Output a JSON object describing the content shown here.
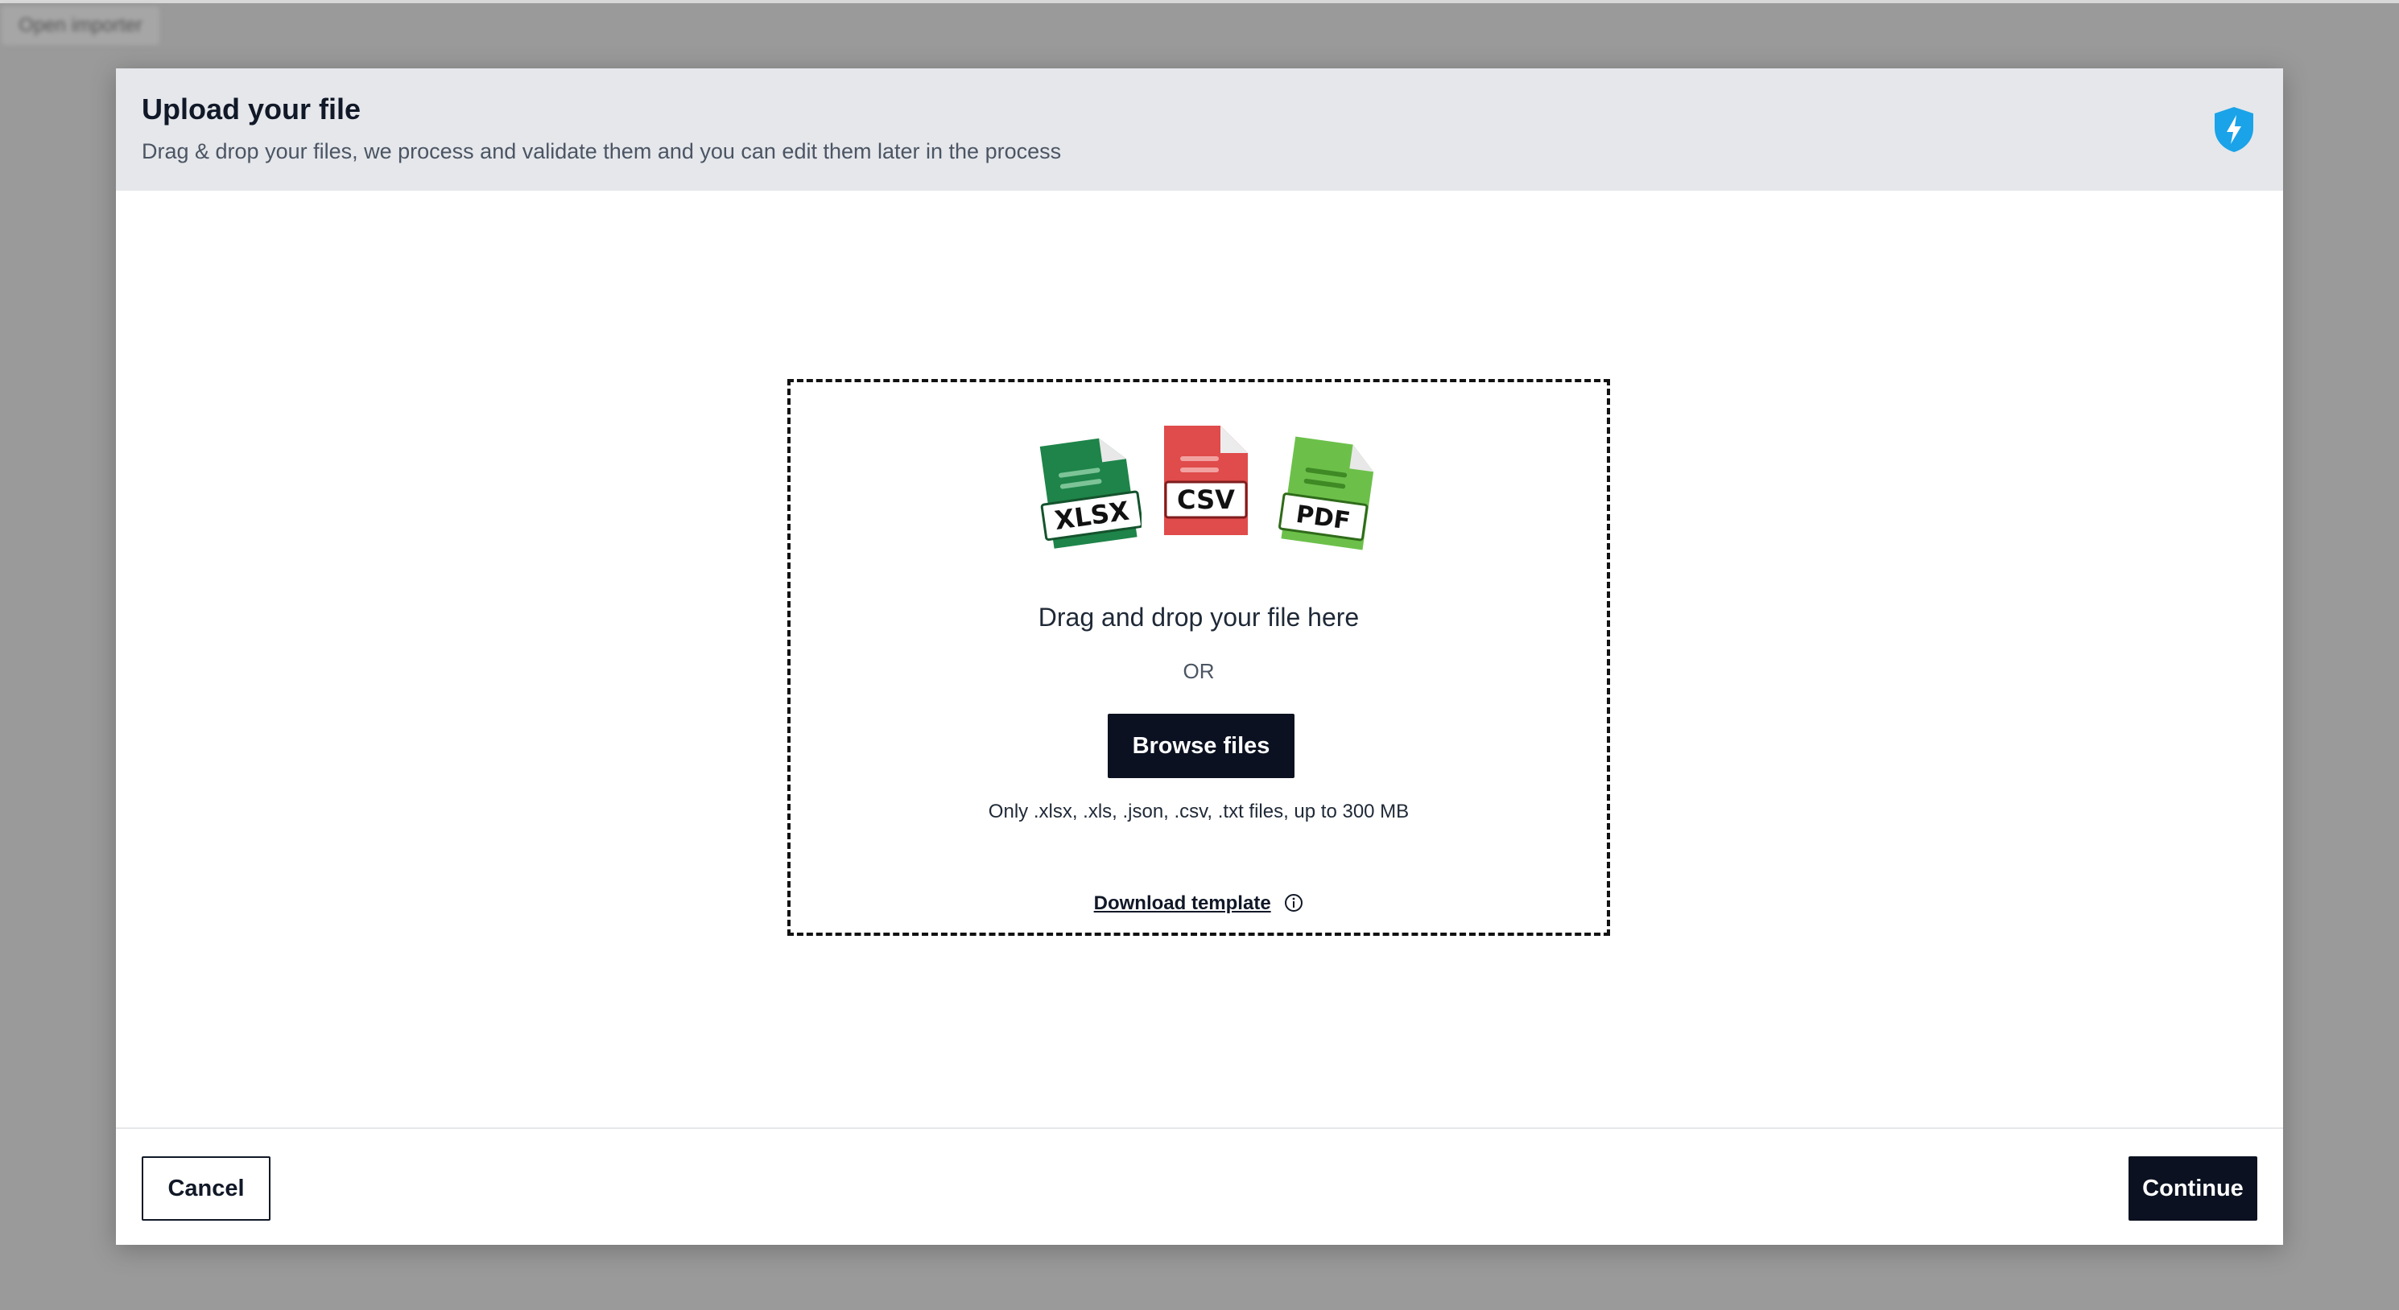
{
  "background": {
    "open_button_label": "Open importer"
  },
  "modal": {
    "title": "Upload your file",
    "subtitle": "Drag & drop your files, we process and validate them and you can edit them later in the process",
    "brand_icon": "shield-bolt-icon"
  },
  "dropzone": {
    "file_types": [
      {
        "label": "XLSX",
        "color": "#1e8449",
        "icon": "xlsx-file-icon"
      },
      {
        "label": "CSV",
        "color": "#e04b4b",
        "icon": "csv-file-icon"
      },
      {
        "label": "PDF",
        "color": "#6cc04a",
        "icon": "pdf-file-icon"
      }
    ],
    "title": "Drag and drop your file here",
    "or_text": "OR",
    "browse_label": "Browse files",
    "hint": "Only .xlsx, .xls, .json, .csv, .txt files, up to 300 MB",
    "template_label": "Download template",
    "template_icon": "info-icon"
  },
  "footer": {
    "cancel_label": "Cancel",
    "continue_label": "Continue"
  },
  "colors": {
    "accent": "#0b1120",
    "header_bg": "#e5e7eb",
    "brand": "#1aa3e8"
  }
}
